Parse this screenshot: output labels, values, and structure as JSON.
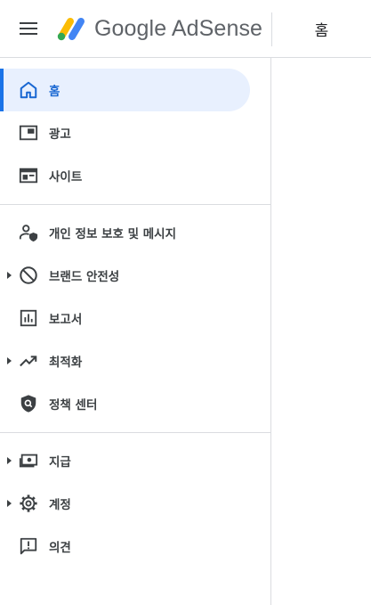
{
  "app": {
    "name": "Google AdSense",
    "page_title": "홈"
  },
  "sidebar": {
    "items": [
      {
        "label": "홈",
        "icon": "home-icon",
        "active": true
      },
      {
        "label": "광고",
        "icon": "ads-icon"
      },
      {
        "label": "사이트",
        "icon": "sites-icon"
      },
      {
        "label": "개인 정보 보호 및 메시지",
        "icon": "privacy-messaging-icon"
      },
      {
        "label": "브랜드 안전성",
        "icon": "block-icon",
        "expandable": true
      },
      {
        "label": "보고서",
        "icon": "reports-icon"
      },
      {
        "label": "최적화",
        "icon": "trending-up-icon",
        "expandable": true
      },
      {
        "label": "정책 센터",
        "icon": "policy-shield-icon"
      },
      {
        "label": "지급",
        "icon": "payments-icon",
        "expandable": true
      },
      {
        "label": "계정",
        "icon": "settings-icon",
        "expandable": true
      },
      {
        "label": "의견",
        "icon": "feedback-icon"
      }
    ]
  },
  "colors": {
    "accent": "#1a73e8",
    "active_bg": "#e8f0fe",
    "text": "#3c4043",
    "divider": "#dadce0"
  }
}
